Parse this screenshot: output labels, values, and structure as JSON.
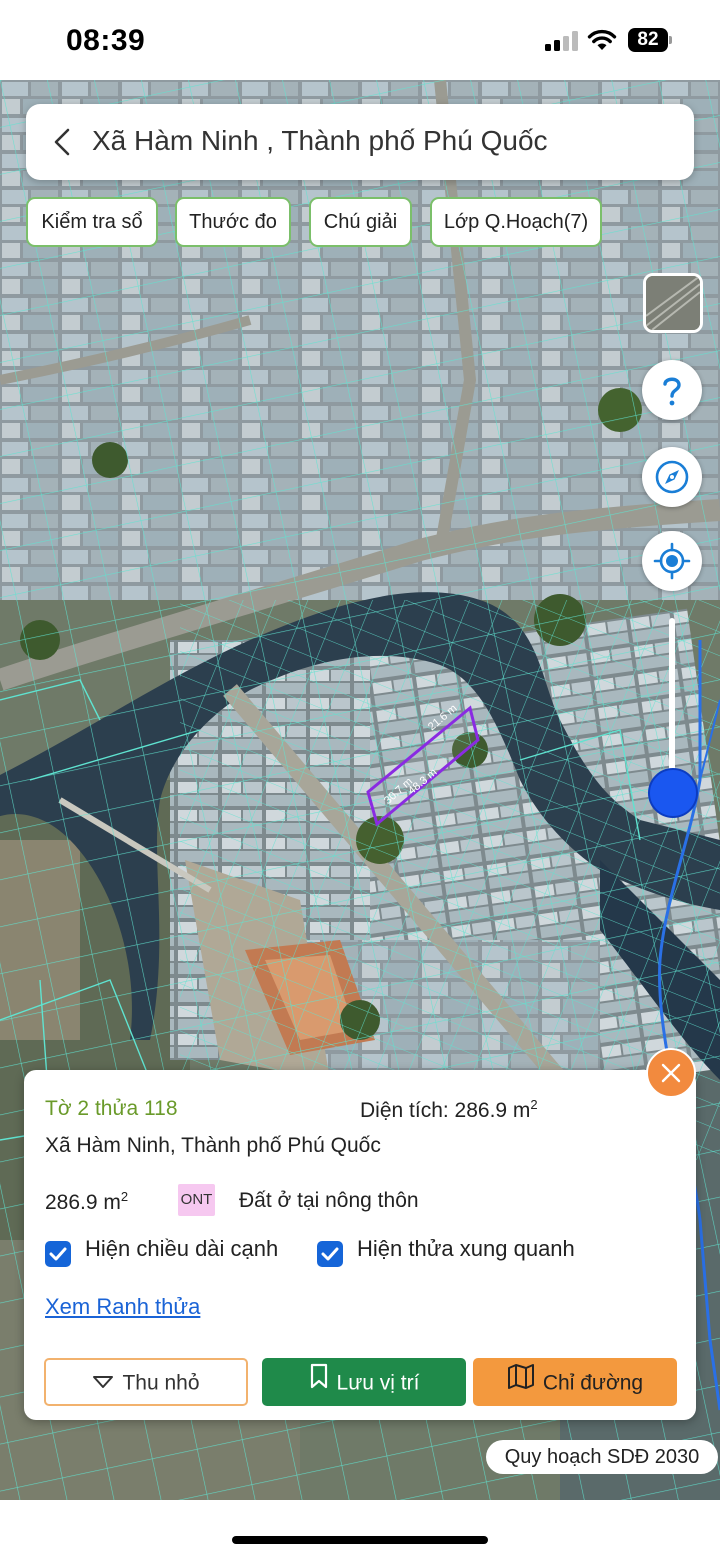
{
  "status_bar": {
    "time": "08:39",
    "battery": "82"
  },
  "header": {
    "title": "Xã Hàm Ninh , Thành phố Phú Quốc"
  },
  "toolbar": {
    "check_book": "Kiểm tra sổ",
    "ruler": "Thước đo",
    "legend": "Chú giải",
    "planning_layers": "Lớp Q.Hoạch(7)"
  },
  "map": {
    "measure_top": "21.6 m",
    "measure_left": "30.7 m",
    "measure_bottom": "48.3 m",
    "parcel_outline_color": "#8a2be2",
    "boundary_color": "#5fe3d0"
  },
  "controls": {
    "help_icon": "question-icon",
    "compass_icon": "compass-icon",
    "locate_icon": "crosshair-icon",
    "zoom_level": 0.95
  },
  "panel": {
    "parcel_id": "Tờ 2 thửa 118",
    "area_label": "Diện tích: 286.9 m",
    "area_unit_sup": "2",
    "address": "Xã Hàm Ninh, Thành phố Phú Quốc",
    "area_value": "286.9 m",
    "area_value_sup": "2",
    "land_code": "ONT",
    "land_type": "Đất ở tại nông thôn",
    "show_edge_lengths": "Hiện chiều dài cạnh",
    "show_edge_lengths_checked": true,
    "show_neighbors": "Hiện thửa xung quanh",
    "show_neighbors_checked": true,
    "view_boundary_link": "Xem Ranh thửa",
    "shrink_button": "Thu nhỏ",
    "save_button": "Lưu vị trí",
    "route_button": "Chỉ đường"
  },
  "plan_badge": "Quy hoạch SDĐ 2030",
  "colors": {
    "accent_green": "#1f8a4a",
    "accent_orange": "#f3993e",
    "link_blue": "#1a63d6",
    "checkbox_blue": "#1565d8"
  }
}
